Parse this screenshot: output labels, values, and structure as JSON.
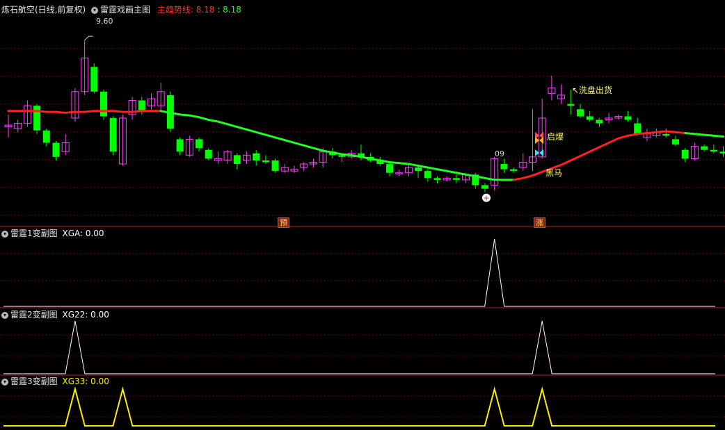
{
  "header": {
    "stock_name": "炼石航空(日线,前复权)",
    "indicator_name": "雷霆戏画主图",
    "trend_label": "主趋势线: 8.18",
    "trend_value2": ": 8.18"
  },
  "main_annotations": {
    "high_price": "9.60",
    "low_price": "09",
    "wash_out": "↖洗盘出货",
    "explode": "启爆",
    "black_horse": "黑马",
    "pre_marker": "预",
    "rise_marker": "涨"
  },
  "colors": {
    "up_candle": "#ff40ff",
    "down_candle": "#00ff00",
    "trend_up": "#ff2020",
    "trend_down": "#20ff20",
    "sub1_line": "#ffffff",
    "sub2_line": "#ffffff",
    "sub3_line": "#ffee00",
    "grid": "#7a0000"
  },
  "sub_panels": [
    {
      "title": "雷霆1变副图",
      "series_label": "XGA: 0.00"
    },
    {
      "title": "雷霆2变副图",
      "series_label": "XG22: 0.00"
    },
    {
      "title": "雷霆3变副图",
      "series_label": "XG33: 0.00"
    }
  ],
  "chart_data": [
    {
      "type": "candlestick",
      "title": "雷霆戏画主图",
      "candles": [
        [
          8.62,
          8.64,
          8.5,
          8.76
        ],
        [
          8.6,
          8.66,
          8.56,
          8.7
        ],
        [
          8.66,
          8.86,
          8.62,
          8.92
        ],
        [
          8.86,
          8.58,
          8.54,
          8.88
        ],
        [
          8.58,
          8.44,
          8.4,
          8.6
        ],
        [
          8.44,
          8.28,
          8.24,
          8.46
        ],
        [
          8.34,
          8.44,
          8.3,
          8.54
        ],
        [
          8.72,
          9.02,
          8.68,
          9.06
        ],
        [
          9.02,
          9.4,
          8.98,
          9.6
        ],
        [
          9.3,
          9.02,
          9.0,
          9.34
        ],
        [
          9.02,
          8.74,
          8.7,
          9.04
        ],
        [
          8.72,
          8.34,
          8.3,
          8.74
        ],
        [
          8.2,
          8.72,
          8.18,
          8.76
        ],
        [
          8.76,
          8.92,
          8.7,
          8.96
        ],
        [
          8.92,
          8.8,
          8.76,
          8.96
        ],
        [
          8.86,
          8.94,
          8.82,
          9.0
        ],
        [
          8.86,
          9.02,
          8.8,
          9.12
        ],
        [
          8.98,
          8.6,
          8.56,
          9.02
        ],
        [
          8.48,
          8.34,
          8.3,
          8.5
        ],
        [
          8.3,
          8.48,
          8.28,
          8.52
        ],
        [
          8.48,
          8.38,
          8.34,
          8.5
        ],
        [
          8.36,
          8.26,
          8.24,
          8.38
        ],
        [
          8.24,
          8.26,
          8.2,
          8.34
        ],
        [
          8.24,
          8.34,
          8.2,
          8.36
        ],
        [
          8.3,
          8.2,
          8.14,
          8.32
        ],
        [
          8.24,
          8.3,
          8.2,
          8.34
        ],
        [
          8.32,
          8.24,
          8.18,
          8.36
        ],
        [
          8.24,
          8.22,
          8.2,
          8.3
        ],
        [
          8.24,
          8.12,
          8.1,
          8.26
        ],
        [
          8.12,
          8.16,
          8.1,
          8.2
        ],
        [
          8.12,
          8.14,
          8.1,
          8.18
        ],
        [
          8.16,
          8.2,
          8.12,
          8.22
        ],
        [
          8.2,
          8.22,
          8.16,
          8.26
        ],
        [
          8.22,
          8.34,
          8.16,
          8.38
        ],
        [
          8.34,
          8.3,
          8.26,
          8.38
        ],
        [
          8.3,
          8.28,
          8.22,
          8.32
        ],
        [
          8.28,
          8.32,
          8.26,
          8.36
        ],
        [
          8.32,
          8.28,
          8.24,
          8.42
        ],
        [
          8.28,
          8.24,
          8.22,
          8.32
        ],
        [
          8.24,
          8.2,
          8.18,
          8.28
        ],
        [
          8.2,
          8.1,
          8.06,
          8.22
        ],
        [
          8.1,
          8.1,
          8.06,
          8.14
        ],
        [
          8.1,
          8.16,
          8.06,
          8.2
        ],
        [
          8.16,
          8.12,
          8.04,
          8.18
        ],
        [
          8.12,
          8.04,
          8.0,
          8.14
        ],
        [
          8.04,
          8.02,
          7.98,
          8.06
        ],
        [
          8.02,
          8.04,
          8.0,
          8.06
        ],
        [
          8.04,
          8.02,
          7.98,
          8.08
        ],
        [
          8.02,
          8.08,
          7.98,
          8.1
        ],
        [
          8.08,
          7.96,
          7.92,
          8.1
        ],
        [
          7.96,
          7.92,
          7.88,
          7.98
        ],
        [
          7.96,
          8.26,
          7.9,
          8.28
        ],
        [
          8.2,
          8.14,
          8.1,
          8.26
        ],
        [
          8.14,
          8.12,
          8.1,
          8.16
        ],
        [
          8.16,
          8.22,
          8.12,
          8.32
        ],
        [
          8.22,
          8.28,
          8.12,
          8.82
        ],
        [
          8.28,
          8.72,
          8.26,
          8.94
        ],
        [
          9.0,
          9.06,
          8.92,
          9.2
        ],
        [
          8.94,
          8.98,
          8.88,
          9.1
        ],
        [
          8.88,
          8.86,
          8.76,
          9.04
        ],
        [
          8.82,
          8.74,
          8.72,
          8.88
        ],
        [
          8.74,
          8.7,
          8.68,
          8.8
        ],
        [
          8.7,
          8.66,
          8.62,
          8.72
        ],
        [
          8.7,
          8.72,
          8.66,
          8.78
        ],
        [
          8.72,
          8.74,
          8.7,
          8.76
        ],
        [
          8.74,
          8.7,
          8.68,
          8.8
        ],
        [
          8.66,
          8.54,
          8.52,
          8.72
        ],
        [
          8.5,
          8.54,
          8.46,
          8.6
        ],
        [
          8.52,
          8.56,
          8.5,
          8.6
        ],
        [
          8.54,
          8.52,
          8.5,
          8.6
        ],
        [
          8.48,
          8.42,
          8.4,
          8.52
        ],
        [
          8.36,
          8.26,
          8.22,
          8.38
        ],
        [
          8.26,
          8.4,
          8.24,
          8.44
        ],
        [
          8.4,
          8.36,
          8.34,
          8.42
        ],
        [
          8.36,
          8.34,
          8.32,
          8.42
        ],
        [
          8.34,
          8.32,
          8.28,
          8.4
        ]
      ],
      "trend_line": [
        8.8,
        8.8,
        8.8,
        8.8,
        8.79,
        8.79,
        8.78,
        8.79,
        8.79,
        8.8,
        8.8,
        8.8,
        8.79,
        8.79,
        8.8,
        8.8,
        8.8,
        8.78,
        8.76,
        8.75,
        8.73,
        8.7,
        8.68,
        8.65,
        8.62,
        8.59,
        8.56,
        8.53,
        8.5,
        8.47,
        8.44,
        8.41,
        8.38,
        8.35,
        8.33,
        8.31,
        8.3,
        8.28,
        8.26,
        8.24,
        8.22,
        8.21,
        8.2,
        8.18,
        8.16,
        8.14,
        8.12,
        8.1,
        8.08,
        8.06,
        8.04,
        8.02,
        8.02,
        8.02,
        8.04,
        8.07,
        8.11,
        8.15,
        8.19,
        8.24,
        8.29,
        8.34,
        8.39,
        8.44,
        8.49,
        8.52,
        8.54,
        8.55,
        8.56,
        8.57,
        8.56,
        8.55,
        8.54,
        8.53,
        8.52,
        8.51
      ],
      "trend_up_ranges": [
        [
          0,
          16
        ],
        [
          53,
          71
        ]
      ]
    },
    {
      "type": "line",
      "title": "雷霆1变副图",
      "peaks": [
        51
      ]
    },
    {
      "type": "line",
      "title": "雷霆2变副图",
      "peaks": [
        7,
        56
      ]
    },
    {
      "type": "line",
      "title": "雷霆3变副图",
      "peaks": [
        7,
        12,
        51,
        56
      ]
    }
  ]
}
